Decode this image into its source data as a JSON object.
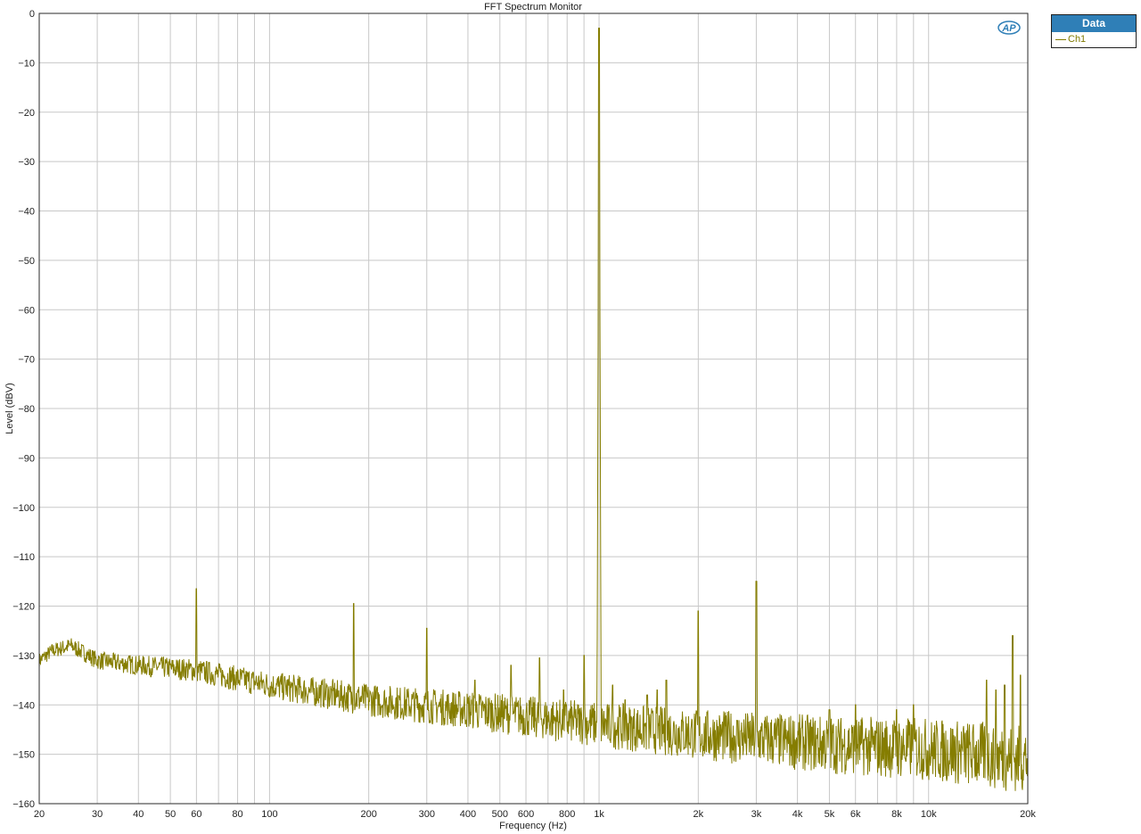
{
  "colors": {
    "trace": "#857d00",
    "grid": "#c8c8c8",
    "frame": "#2a2a2a",
    "legend_header": "#2f7fb7",
    "logo": "#2f7fb7"
  },
  "logo": {
    "text": "AP"
  },
  "legend": {
    "title": "Data",
    "items": [
      {
        "label": "Ch1",
        "color": "#857d00"
      }
    ]
  },
  "chart_data": {
    "type": "line",
    "title": "FFT Spectrum Monitor",
    "xlabel": "Frequency (Hz)",
    "ylabel": "Level (dBV)",
    "xscale": "log",
    "xlim": [
      20,
      20000
    ],
    "ylim": [
      -160,
      0
    ],
    "grid": true,
    "legend_position": "outside-top-right",
    "x_ticks": [
      {
        "value": 20,
        "label": "20"
      },
      {
        "value": 30,
        "label": "30"
      },
      {
        "value": 40,
        "label": "40"
      },
      {
        "value": 50,
        "label": "50"
      },
      {
        "value": 60,
        "label": "60"
      },
      {
        "value": 80,
        "label": "80"
      },
      {
        "value": 100,
        "label": "100"
      },
      {
        "value": 200,
        "label": "200"
      },
      {
        "value": 300,
        "label": "300"
      },
      {
        "value": 400,
        "label": "400"
      },
      {
        "value": 500,
        "label": "500"
      },
      {
        "value": 600,
        "label": "600"
      },
      {
        "value": 800,
        "label": "800"
      },
      {
        "value": 1000,
        "label": "1k"
      },
      {
        "value": 2000,
        "label": "2k"
      },
      {
        "value": 3000,
        "label": "3k"
      },
      {
        "value": 4000,
        "label": "4k"
      },
      {
        "value": 5000,
        "label": "5k"
      },
      {
        "value": 6000,
        "label": "6k"
      },
      {
        "value": 8000,
        "label": "8k"
      },
      {
        "value": 10000,
        "label": "10k"
      },
      {
        "value": 20000,
        "label": "20k"
      }
    ],
    "y_ticks": [
      0,
      -10,
      -20,
      -30,
      -40,
      -50,
      -60,
      -70,
      -80,
      -90,
      -100,
      -110,
      -120,
      -130,
      -140,
      -150,
      -160
    ],
    "series": [
      {
        "name": "Ch1",
        "color": "#857d00",
        "noise_floor": [
          [
            20,
            -131
          ],
          [
            22,
            -129
          ],
          [
            25,
            -128
          ],
          [
            30,
            -131
          ],
          [
            40,
            -132
          ],
          [
            60,
            -133
          ],
          [
            100,
            -136
          ],
          [
            200,
            -139
          ],
          [
            400,
            -141
          ],
          [
            1000,
            -144
          ],
          [
            2000,
            -146
          ],
          [
            5000,
            -148
          ],
          [
            10000,
            -149
          ],
          [
            20000,
            -151
          ]
        ],
        "peaks": [
          {
            "x": 60,
            "y": -116.5
          },
          {
            "x": 180,
            "y": -119.5
          },
          {
            "x": 300,
            "y": -124.5
          },
          {
            "x": 420,
            "y": -135
          },
          {
            "x": 540,
            "y": -132
          },
          {
            "x": 660,
            "y": -130.5
          },
          {
            "x": 780,
            "y": -137
          },
          {
            "x": 900,
            "y": -130
          },
          {
            "x": 1000,
            "y": -3
          },
          {
            "x": 1100,
            "y": -136
          },
          {
            "x": 1200,
            "y": -139
          },
          {
            "x": 1400,
            "y": -138
          },
          {
            "x": 1500,
            "y": -137
          },
          {
            "x": 1600,
            "y": -135
          },
          {
            "x": 2000,
            "y": -121
          },
          {
            "x": 3000,
            "y": -115
          },
          {
            "x": 5000,
            "y": -141
          },
          {
            "x": 6000,
            "y": -140
          },
          {
            "x": 8000,
            "y": -141
          },
          {
            "x": 9000,
            "y": -140
          },
          {
            "x": 15000,
            "y": -135
          },
          {
            "x": 16000,
            "y": -137
          },
          {
            "x": 17000,
            "y": -136
          },
          {
            "x": 18000,
            "y": -126
          },
          {
            "x": 19000,
            "y": -134
          }
        ]
      }
    ]
  }
}
